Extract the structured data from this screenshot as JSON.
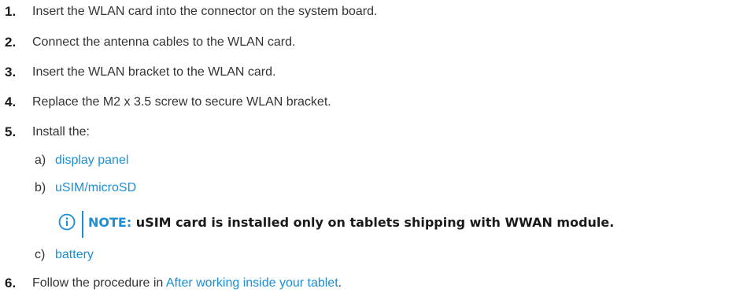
{
  "steps": [
    {
      "number": "1.",
      "text": "Insert the WLAN card into the connector on the system board."
    },
    {
      "number": "2.",
      "text": "Connect the antenna cables to the WLAN card."
    },
    {
      "number": "3.",
      "text": "Insert the WLAN bracket to the WLAN card."
    },
    {
      "number": "4.",
      "text": "Replace the M2 x 3.5 screw to secure WLAN bracket."
    },
    {
      "number": "5.",
      "text": "Install the:"
    },
    {
      "number": "6.",
      "text_before": "Follow the procedure in ",
      "link": "After working inside your tablet",
      "text_after": "."
    }
  ],
  "substeps": [
    {
      "letter": "a)",
      "link": "display panel"
    },
    {
      "letter": "b)",
      "link": "uSIM/microSD"
    },
    {
      "letter": "c)",
      "link": "battery"
    }
  ],
  "note": {
    "label": "NOTE:",
    "text": " uSIM card is installed only on tablets shipping with WWAN module.",
    "icon": "info-icon"
  },
  "colors": {
    "link": "#1a8fd6",
    "text": "#333333"
  }
}
